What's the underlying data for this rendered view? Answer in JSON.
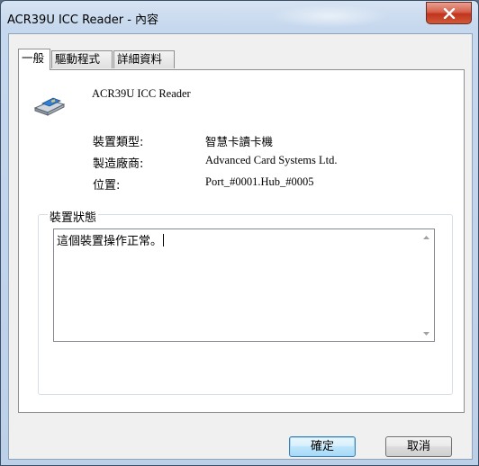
{
  "window": {
    "title": "ACR39U ICC Reader - 內容",
    "close_label": "close"
  },
  "tabs": [
    {
      "label": "一般",
      "active": true
    },
    {
      "label": "驅動程式",
      "active": false
    },
    {
      "label": "詳細資料",
      "active": false
    }
  ],
  "device": {
    "name": "ACR39U ICC Reader",
    "icon": "smart-card-reader-icon",
    "properties": [
      {
        "label": "裝置類型:",
        "value": "智慧卡讀卡機"
      },
      {
        "label": "製造廠商:",
        "value": "Advanced Card Systems Ltd."
      },
      {
        "label": "位置:",
        "value": "Port_#0001.Hub_#0005"
      }
    ]
  },
  "status": {
    "group_title": "裝置狀態",
    "text": "這個裝置操作正常。"
  },
  "buttons": {
    "ok": "確定",
    "cancel": "取消"
  },
  "colors": {
    "close_button": "#c1331d",
    "default_button_border": "#3c7fb1"
  }
}
